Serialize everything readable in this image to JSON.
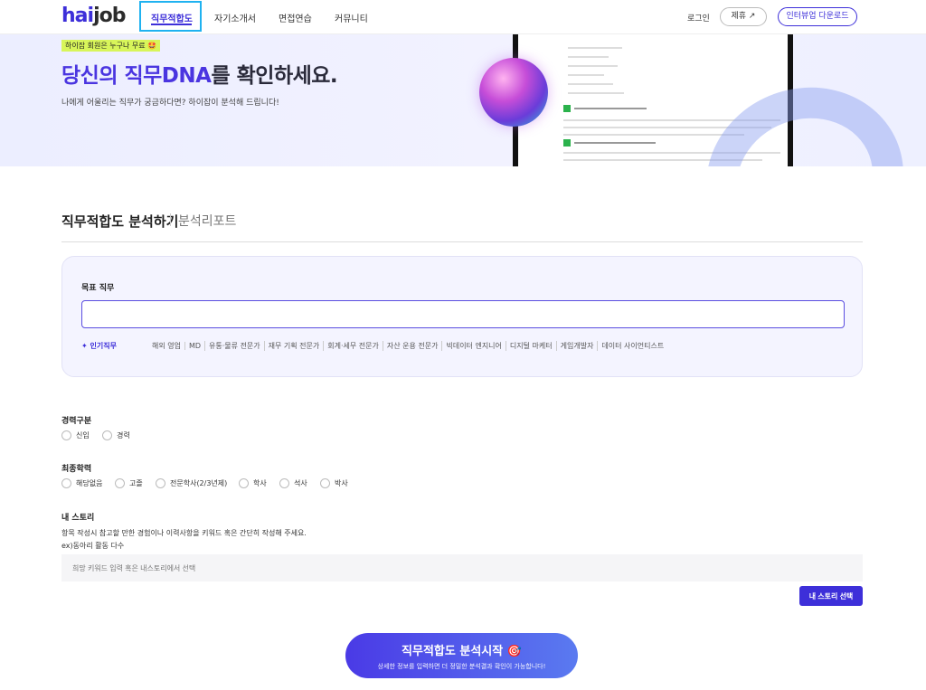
{
  "header": {
    "logo_hai": "hai",
    "logo_job": "job",
    "nav": [
      "직무적합도",
      "자기소개서",
      "면접연습",
      "커뮤니티"
    ],
    "login": "로그인",
    "partner": "제휴 ↗",
    "download": "인터뷰업 다운로드"
  },
  "banner": {
    "badge": "하이잡 회원은 누구나 무료 🤩",
    "title_part1": "당신의 직무DNA",
    "title_part2": "를 확인하세요.",
    "subtitle": "나에게 어울리는 직무가 궁금하다면? 하이잡이 분석해 드립니다!"
  },
  "tabs": {
    "analyze": "직무적합도 분석하기",
    "report": "분석리포트"
  },
  "target_job": {
    "label": "목표 직무",
    "popular_label": "인기직무",
    "chips": [
      "해외 영업",
      "MD",
      "유통·물류 전문가",
      "재무 기획 전문가",
      "회계·세무 전문가",
      "자산 운용 전문가",
      "빅데이터 엔지니어",
      "디지털 마케터",
      "게임개발자",
      "데이터 사이언티스트"
    ]
  },
  "career": {
    "label": "경력구분",
    "options": [
      "신입",
      "경력"
    ]
  },
  "education": {
    "label": "최종학력",
    "options": [
      "해당없음",
      "고졸",
      "전문학사(2/3년제)",
      "학사",
      "석사",
      "박사"
    ]
  },
  "story": {
    "label": "내 스토리",
    "desc1": "항목 작성시 참고할 만한 경험이나 이력사항을 키워드 혹은 간단히 작성해 주세요.",
    "desc2": "ex)동아리 활동 다수",
    "placeholder": "희망 키워드 입력 혹은 내스토리에서 선택",
    "button": "내 스토리 선택"
  },
  "cta": {
    "title": "직무적합도 분석시작 🎯",
    "subtitle": "상세한 정보를 입력하면 더 정밀한 분석결과 확인이 가능합니다!"
  },
  "colors": {
    "accent": "#3d2fd9",
    "highlight": "#1fb2f0",
    "badge": "#d8f55a"
  }
}
